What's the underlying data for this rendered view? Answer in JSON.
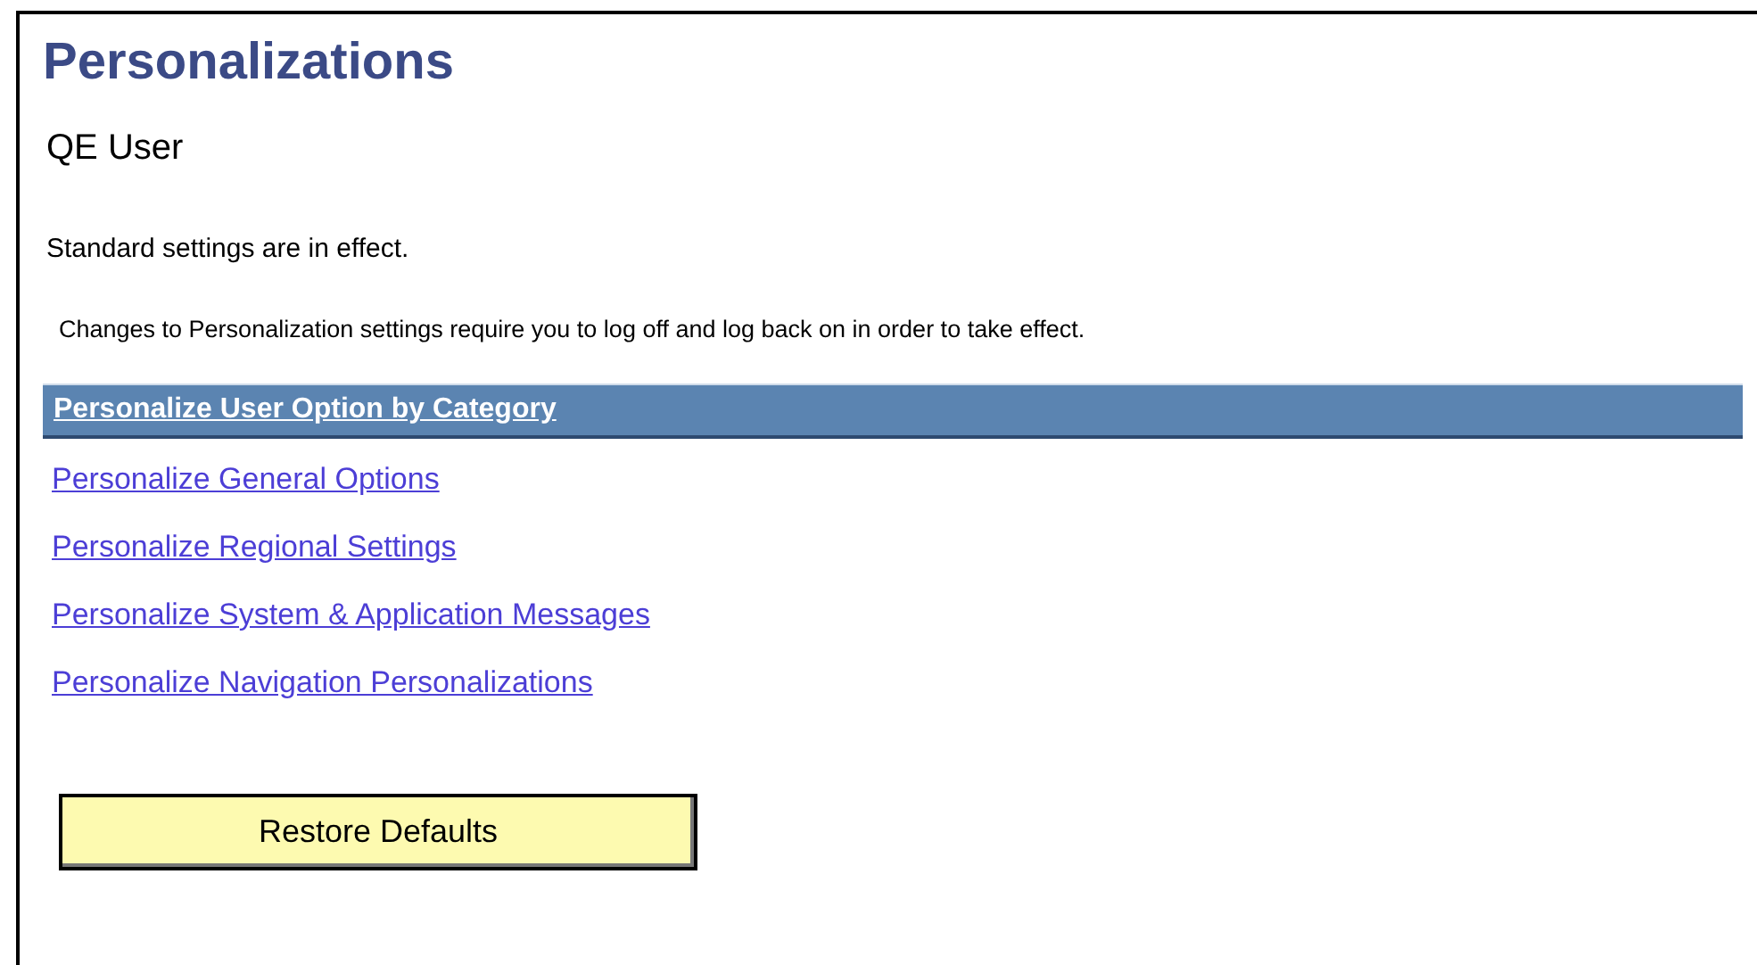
{
  "page": {
    "title": "Personalizations",
    "user": "QE User",
    "status": "Standard settings are in effect.",
    "note": "Changes to Personalization settings require you to log off and log back on in order to take effect."
  },
  "category_header": "Personalize User Option by Category",
  "links": [
    "Personalize General Options",
    "Personalize Regional Settings",
    "Personalize System & Application Messages",
    "Personalize Navigation Personalizations"
  ],
  "buttons": [
    "Restore Defaults"
  ]
}
